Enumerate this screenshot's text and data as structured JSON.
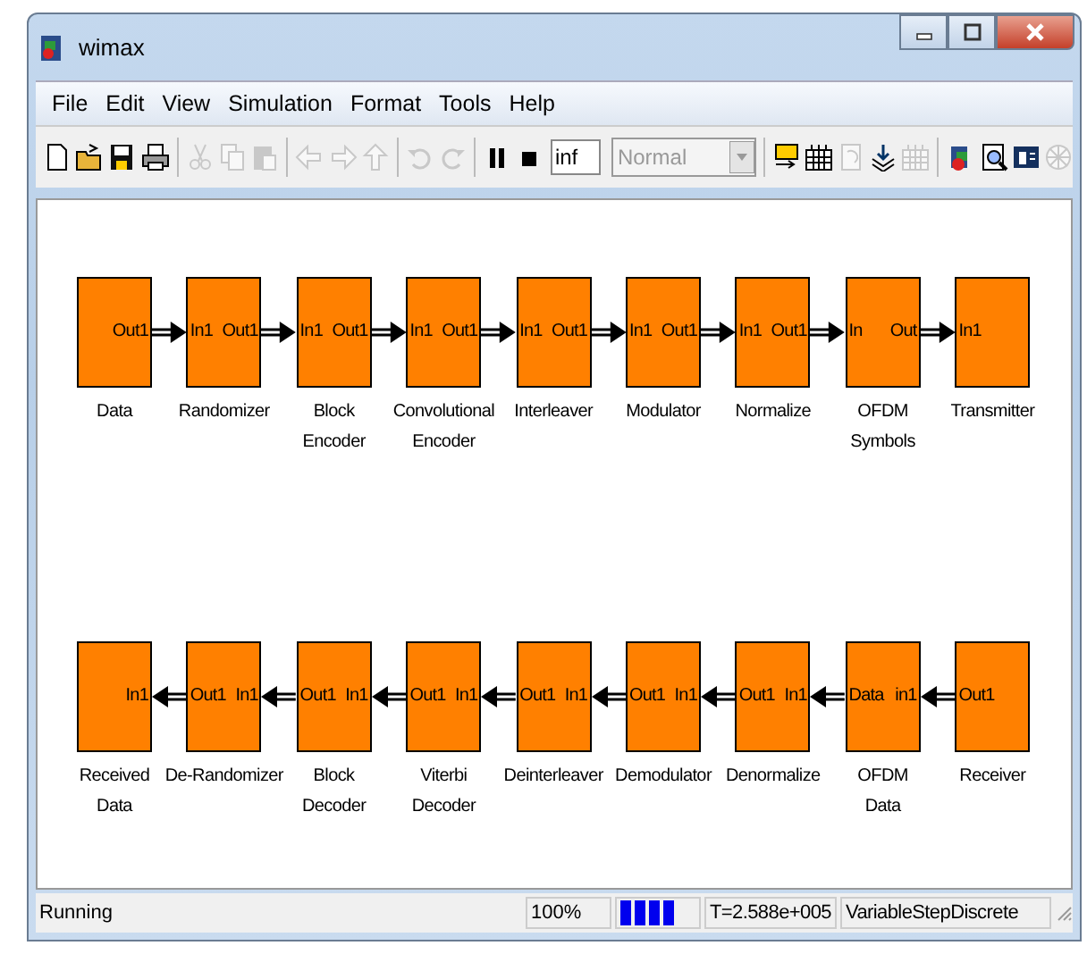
{
  "window": {
    "title": "wimax"
  },
  "menu": [
    "File",
    "Edit",
    "View",
    "Simulation",
    "Format",
    "Tools",
    "Help"
  ],
  "toolbar": [
    {
      "kind": "new",
      "disabled": false
    },
    {
      "kind": "open",
      "disabled": false
    },
    {
      "kind": "save",
      "disabled": false
    },
    {
      "kind": "print",
      "disabled": false
    },
    {
      "kind": "sep"
    },
    {
      "kind": "cut",
      "disabled": true
    },
    {
      "kind": "copy",
      "disabled": true
    },
    {
      "kind": "paste",
      "disabled": true
    },
    {
      "kind": "sep"
    },
    {
      "kind": "back",
      "disabled": true
    },
    {
      "kind": "forward",
      "disabled": true
    },
    {
      "kind": "up",
      "disabled": true
    },
    {
      "kind": "sep"
    },
    {
      "kind": "undo",
      "disabled": true
    },
    {
      "kind": "redo",
      "disabled": true
    },
    {
      "kind": "sep"
    },
    {
      "kind": "pause",
      "disabled": false
    },
    {
      "kind": "stop",
      "disabled": false
    },
    {
      "kind": "time",
      "value": "inf"
    },
    {
      "kind": "mode",
      "value": "Normal",
      "disabled": true
    },
    {
      "kind": "sep"
    },
    {
      "kind": "build",
      "disabled": false
    },
    {
      "kind": "grid",
      "disabled": false
    },
    {
      "kind": "refresh",
      "disabled": true
    },
    {
      "kind": "download",
      "disabled": false
    },
    {
      "kind": "grid",
      "disabled": true
    },
    {
      "kind": "sep"
    },
    {
      "kind": "library",
      "disabled": false
    },
    {
      "kind": "explorer",
      "disabled": false
    },
    {
      "kind": "panel",
      "disabled": false
    },
    {
      "kind": "wheel",
      "disabled": true
    }
  ],
  "rows": [
    {
      "reversed": false,
      "blocks": [
        {
          "label": "Data",
          "right_port": "Out1"
        },
        {
          "label": "Randomizer",
          "left_port": "In1",
          "right_port": "Out1"
        },
        {
          "label": "Block\nEncoder",
          "left_port": "In1",
          "right_port": "Out1"
        },
        {
          "label": "Convolutional\nEncoder",
          "left_port": "In1",
          "right_port": "Out1"
        },
        {
          "label": "Interleaver",
          "left_port": "In1",
          "right_port": "Out1"
        },
        {
          "label": "Modulator",
          "left_port": "In1",
          "right_port": "Out1"
        },
        {
          "label": "Normalize",
          "left_port": "In1",
          "right_port": "Out1"
        },
        {
          "label": "OFDM\nSymbols",
          "left_port": "In",
          "right_port": "Out"
        },
        {
          "label": "Transmitter",
          "left_port": "In1"
        }
      ]
    },
    {
      "reversed": true,
      "blocks": [
        {
          "label": "Received\nData",
          "right_port": "In1"
        },
        {
          "label": "De-Randomizer",
          "left_port": "Out1",
          "right_port": "In1"
        },
        {
          "label": "Block\nDecoder",
          "left_port": "Out1",
          "right_port": "In1"
        },
        {
          "label": "Viterbi\nDecoder",
          "left_port": "Out1",
          "right_port": "In1"
        },
        {
          "label": "Deinterleaver",
          "left_port": "Out1",
          "right_port": "In1"
        },
        {
          "label": "Demodulator",
          "left_port": "Out1",
          "right_port": "In1"
        },
        {
          "label": "Denormalize",
          "left_port": "Out1",
          "right_port": "In1"
        },
        {
          "label": "OFDM\nData",
          "left_port": "Data",
          "right_port": "in1"
        },
        {
          "label": "Receiver",
          "left_port": "Out1"
        }
      ]
    }
  ],
  "status_bar": {
    "state": "Running",
    "zoom": "100%",
    "time": "T=2.588e+005",
    "solver": "VariableStepDiscrete"
  }
}
